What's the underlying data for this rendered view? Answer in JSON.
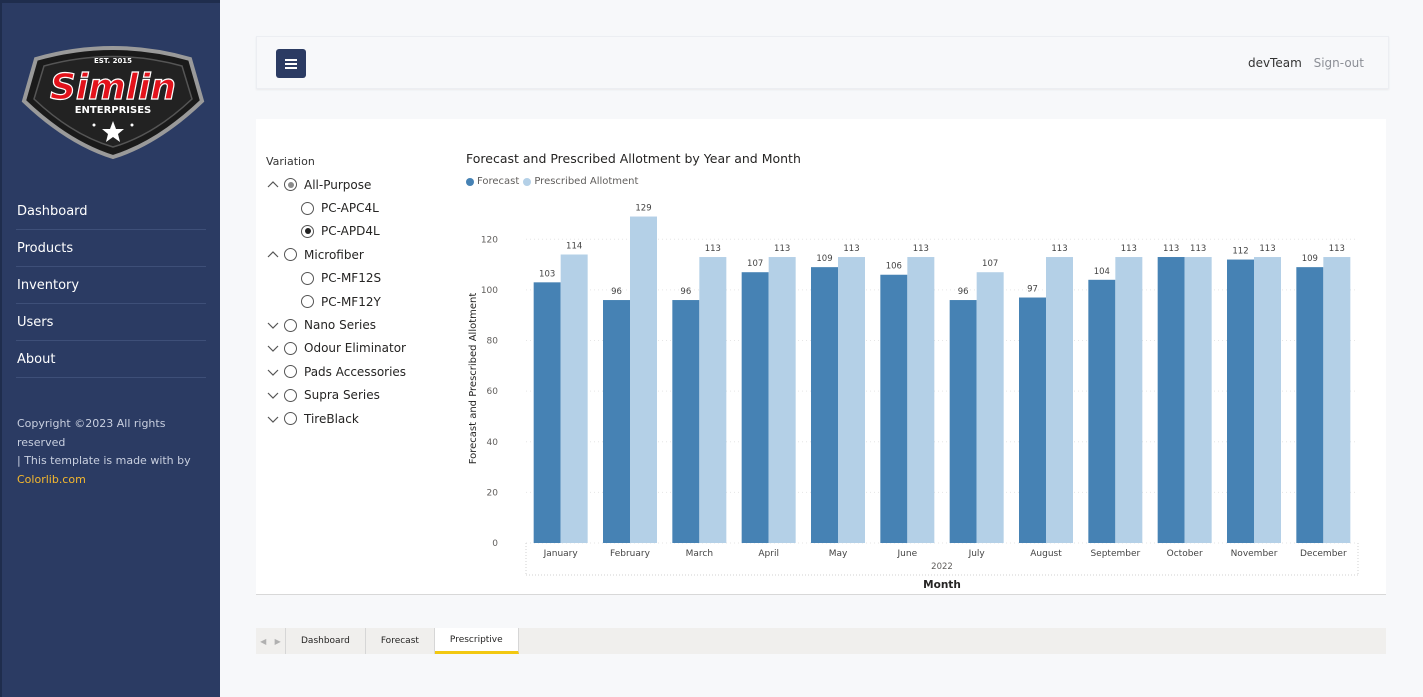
{
  "sidebar": {
    "logo": {
      "est": "EST. 2015",
      "name": "Simlin",
      "sub": "ENTERPRISES"
    },
    "items": [
      {
        "label": "Dashboard"
      },
      {
        "label": "Products"
      },
      {
        "label": "Inventory"
      },
      {
        "label": "Users"
      },
      {
        "label": "About"
      }
    ],
    "footer": {
      "line1": "Copyright ©2023 All rights reserved",
      "line2": "| This template is made with by",
      "link": "Colorlib.com"
    }
  },
  "topbar": {
    "user": "devTeam",
    "signout": "Sign-out"
  },
  "slicer": {
    "title": "Variation",
    "items": [
      {
        "label": "All-Purpose",
        "level": 0,
        "expanded": true,
        "state": "partial"
      },
      {
        "label": "PC-APC4L",
        "level": 1,
        "state": "off"
      },
      {
        "label": "PC-APD4L",
        "level": 1,
        "state": "checked"
      },
      {
        "label": "Microfiber",
        "level": 0,
        "expanded": true,
        "state": "off"
      },
      {
        "label": "PC-MF12S",
        "level": 1,
        "state": "off"
      },
      {
        "label": "PC-MF12Y",
        "level": 1,
        "state": "off"
      },
      {
        "label": "Nano Series",
        "level": 0,
        "expanded": false,
        "state": "off"
      },
      {
        "label": "Odour Eliminator",
        "level": 0,
        "expanded": false,
        "state": "off"
      },
      {
        "label": "Pads Accessories",
        "level": 0,
        "expanded": false,
        "state": "off"
      },
      {
        "label": "Supra Series",
        "level": 0,
        "expanded": false,
        "state": "off"
      },
      {
        "label": "TireBlack",
        "level": 0,
        "expanded": false,
        "state": "off"
      }
    ]
  },
  "chart_data": {
    "type": "bar",
    "title": "Forecast and Prescribed Allotment by Year and Month",
    "xlabel": "Month",
    "xgroup": "2022",
    "ylabel": "Forecast and Prescribed Allotment",
    "ylim": [
      0,
      130
    ],
    "yticks": [
      0,
      20,
      40,
      60,
      80,
      100,
      120
    ],
    "grid": true,
    "legend_position": "top-left",
    "categories": [
      "January",
      "February",
      "March",
      "April",
      "May",
      "June",
      "July",
      "August",
      "September",
      "October",
      "November",
      "December"
    ],
    "series": [
      {
        "name": "Forecast",
        "color": "#4682b4",
        "values": [
          103,
          96,
          96,
          107,
          109,
          106,
          96,
          97,
          104,
          113,
          112,
          109
        ]
      },
      {
        "name": "Prescribed Allotment",
        "color": "#b4d0e7",
        "values": [
          114,
          129,
          113,
          113,
          113,
          113,
          107,
          113,
          113,
          113,
          113,
          113
        ]
      }
    ]
  },
  "tabs": [
    {
      "label": "Dashboard",
      "active": false
    },
    {
      "label": "Forecast",
      "active": false
    },
    {
      "label": "Prescriptive",
      "active": true
    }
  ]
}
